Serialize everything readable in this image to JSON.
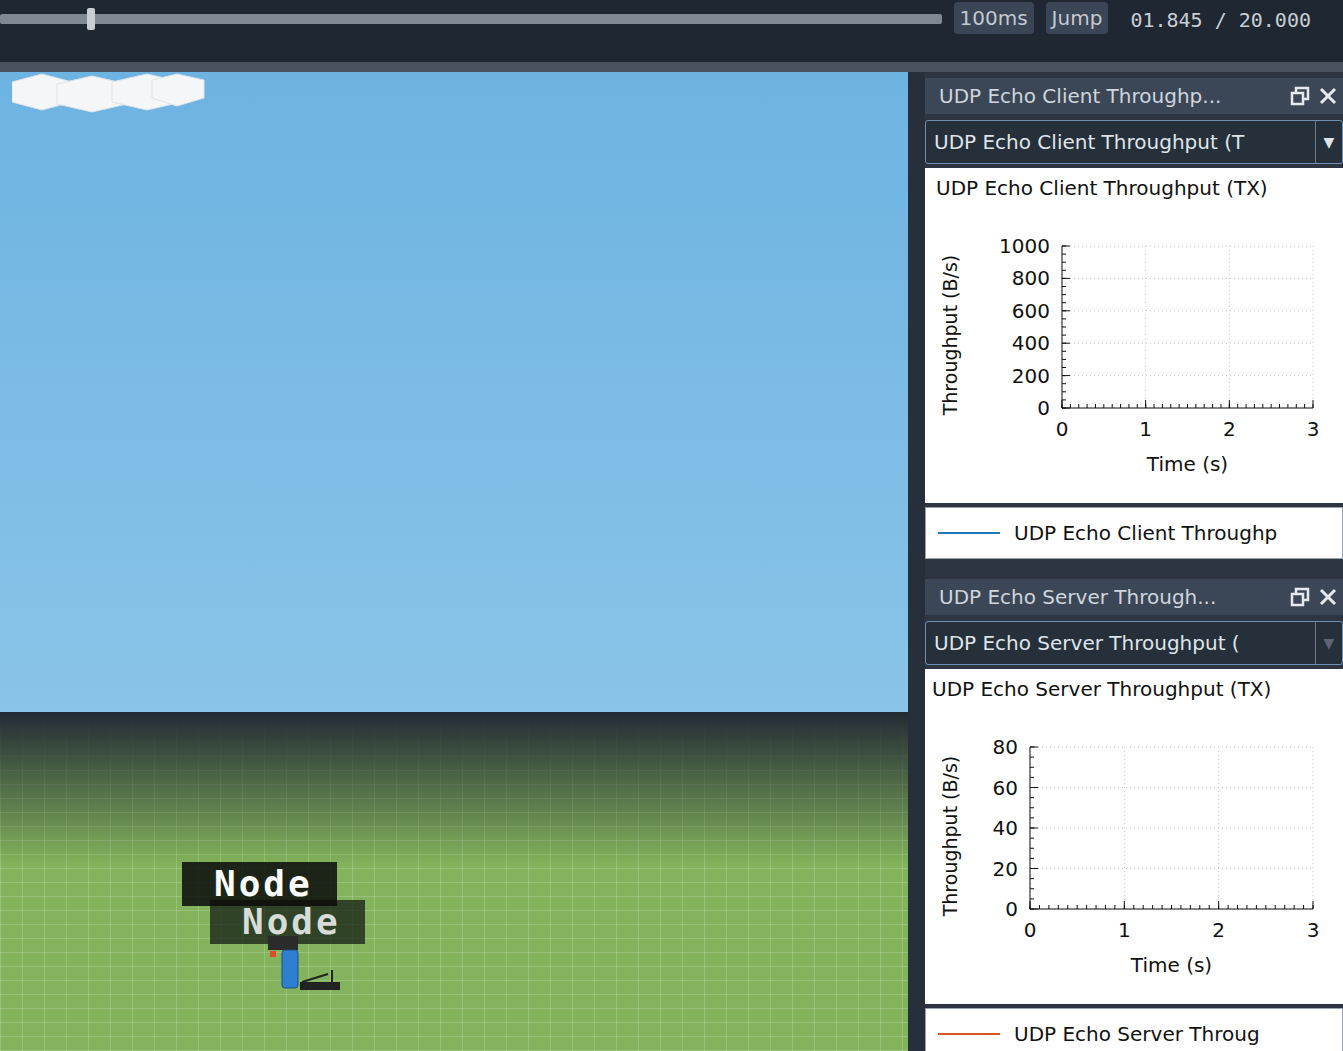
{
  "toolbar": {
    "timeline_level": 0.092,
    "step": "100ms",
    "jump": "Jump",
    "time": "01.845 / 20.000"
  },
  "scene": {
    "labels": [
      {
        "text": "Node",
        "front": true
      },
      {
        "text": "Node",
        "front": false
      }
    ]
  },
  "docks": [
    {
      "title": "UDP Echo Client Throughp...",
      "selector": {
        "value": "UDP Echo Client Throughput (T",
        "disabled": false
      },
      "chart": {
        "title": "UDP Echo Client Throughput (TX)",
        "y_label": "Throughput (B/s)",
        "x_label": "Time (s)",
        "y_ticks": [
          "0",
          "200",
          "400",
          "600",
          "800",
          "1000"
        ],
        "x_ticks": [
          "0",
          "1",
          "2",
          "3"
        ],
        "series": [
          {
            "name": "UDP Echo Client Throughp",
            "color": "#1f77b4",
            "values": []
          }
        ]
      }
    },
    {
      "title": "UDP Echo Server Through...",
      "selector": {
        "value": "UDP Echo Server Throughput (",
        "disabled": true
      },
      "chart": {
        "title": "UDP Echo Server Throughput (TX)",
        "y_label": "Throughput (B/s)",
        "x_label": "Time (s)",
        "y_ticks": [
          "0",
          "20",
          "40",
          "60",
          "80"
        ],
        "x_ticks": [
          "0",
          "1",
          "2",
          "3"
        ],
        "series": [
          {
            "name": "UDP Echo Server Throug",
            "color": "#d9541e",
            "values": []
          }
        ]
      }
    }
  ]
}
